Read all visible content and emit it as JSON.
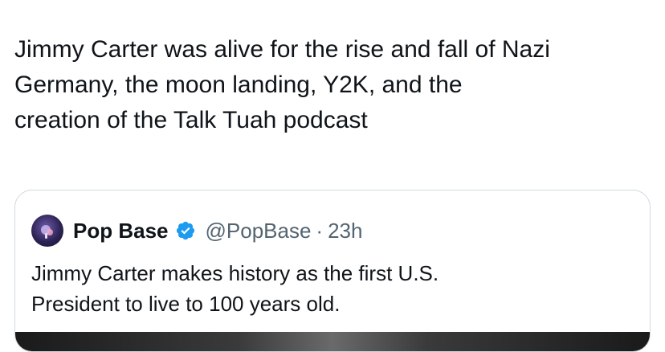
{
  "tweet": {
    "text_lines": [
      "Jimmy Carter was alive for the rise and fall of Nazi",
      "Germany, the moon landing, Y2K, and the",
      "creation of the Talk Tuah podcast"
    ]
  },
  "quote": {
    "avatar_icon": "pop-base-logo-icon",
    "display_name": "Pop Base",
    "verified_icon": "verified-badge-icon",
    "verified_color": "#1d9bf0",
    "handle": "@PopBase",
    "separator": "·",
    "age": "23h",
    "text_lines": [
      "Jimmy Carter makes history as the first U.S.",
      "President to live to 100 years old."
    ]
  }
}
